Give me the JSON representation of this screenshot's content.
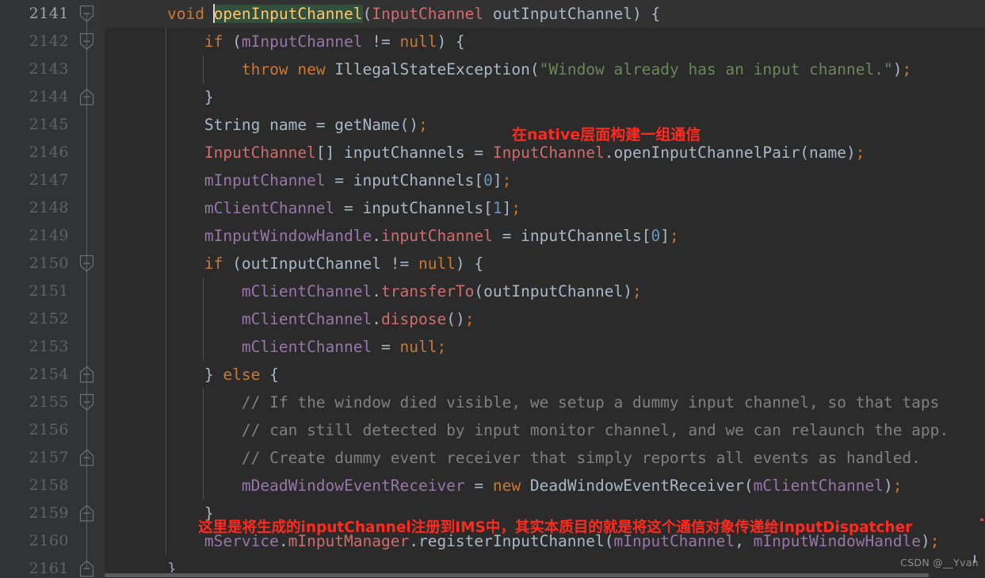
{
  "editor": {
    "first_line": 2141,
    "current_line": 2141,
    "line_numbers": [
      2141,
      2142,
      2143,
      2144,
      2145,
      2146,
      2147,
      2148,
      2149,
      2150,
      2151,
      2152,
      2153,
      2154,
      2155,
      2156,
      2157,
      2158,
      2159,
      2160,
      2161
    ],
    "colors": {
      "background": "#2b2b2b",
      "gutter_background": "#313335",
      "current_line_background": "#323232",
      "line_number": "#606366",
      "current_line_number": "#a4a3a3",
      "default_text": "#a9b7c6",
      "keyword": "#cc7832",
      "class_name": "#d06c6c",
      "field": "#9876aa",
      "string": "#6a8759",
      "number": "#6897bb",
      "comment": "#808080",
      "caret_highlight_bg": "#32503c",
      "caret_highlight_fg": "#ffc66d",
      "annotation_red": "#ff2a1e",
      "indent_guide": "#4b5059",
      "fold_marker": "#6e7072"
    },
    "lines": [
      {
        "n": 2141,
        "current": true,
        "indent": 1,
        "tokens": [
          {
            "t": "    ",
            "c": "plain"
          },
          {
            "t": "void",
            "c": "kw"
          },
          {
            "t": " ",
            "c": "plain"
          },
          {
            "t": "CARET",
            "c": "caret"
          },
          {
            "t": "openInputChannel",
            "c": "hl-ident"
          },
          {
            "t": "(",
            "c": "paren"
          },
          {
            "t": "InputChannel",
            "c": "cls"
          },
          {
            "t": " outInputChannel",
            "c": "plain"
          },
          {
            "t": ") {",
            "c": "plain"
          }
        ]
      },
      {
        "n": 2142,
        "indent": 2,
        "tokens": [
          {
            "t": "        ",
            "c": "plain"
          },
          {
            "t": "if",
            "c": "kw"
          },
          {
            "t": " (",
            "c": "plain"
          },
          {
            "t": "mInputChannel",
            "c": "field"
          },
          {
            "t": " != ",
            "c": "plain"
          },
          {
            "t": "null",
            "c": "kw"
          },
          {
            "t": ") {",
            "c": "plain"
          }
        ]
      },
      {
        "n": 2143,
        "indent": 3,
        "tokens": [
          {
            "t": "            ",
            "c": "plain"
          },
          {
            "t": "throw",
            "c": "kw"
          },
          {
            "t": " ",
            "c": "plain"
          },
          {
            "t": "new",
            "c": "kw"
          },
          {
            "t": " IllegalStateException",
            "c": "plain"
          },
          {
            "t": "(",
            "c": "paren"
          },
          {
            "t": "\"Window already has an input channel.\"",
            "c": "str"
          },
          {
            "t": ")",
            "c": "paren"
          },
          {
            "t": ";",
            "c": "semi"
          }
        ]
      },
      {
        "n": 2144,
        "indent": 2,
        "tokens": [
          {
            "t": "        }",
            "c": "plain"
          }
        ]
      },
      {
        "n": 2145,
        "indent": 2,
        "tokens": [
          {
            "t": "        String name = getName()",
            "c": "plain"
          },
          {
            "t": ";",
            "c": "semi"
          }
        ]
      },
      {
        "n": 2146,
        "indent": 2,
        "tokens": [
          {
            "t": "        ",
            "c": "plain"
          },
          {
            "t": "InputChannel",
            "c": "cls"
          },
          {
            "t": "[] inputChannels = ",
            "c": "plain"
          },
          {
            "t": "InputChannel",
            "c": "cls"
          },
          {
            "t": ".openInputChannelPair(name)",
            "c": "plain"
          },
          {
            "t": ";",
            "c": "semi"
          }
        ]
      },
      {
        "n": 2147,
        "indent": 2,
        "tokens": [
          {
            "t": "        ",
            "c": "plain"
          },
          {
            "t": "mInputChannel",
            "c": "field"
          },
          {
            "t": " = inputChannels[",
            "c": "plain"
          },
          {
            "t": "0",
            "c": "num"
          },
          {
            "t": "]",
            "c": "plain"
          },
          {
            "t": ";",
            "c": "semi"
          }
        ]
      },
      {
        "n": 2148,
        "indent": 2,
        "tokens": [
          {
            "t": "        ",
            "c": "plain"
          },
          {
            "t": "mClientChannel",
            "c": "field"
          },
          {
            "t": " = inputChannels[",
            "c": "plain"
          },
          {
            "t": "1",
            "c": "num"
          },
          {
            "t": "]",
            "c": "plain"
          },
          {
            "t": ";",
            "c": "semi"
          }
        ]
      },
      {
        "n": 2149,
        "indent": 2,
        "tokens": [
          {
            "t": "        ",
            "c": "plain"
          },
          {
            "t": "mInputWindowHandle",
            "c": "field"
          },
          {
            "t": ".",
            "c": "plain"
          },
          {
            "t": "inputChannel",
            "c": "cls"
          },
          {
            "t": " = inputChannels[",
            "c": "plain"
          },
          {
            "t": "0",
            "c": "num"
          },
          {
            "t": "]",
            "c": "plain"
          },
          {
            "t": ";",
            "c": "semi"
          }
        ]
      },
      {
        "n": 2150,
        "indent": 2,
        "tokens": [
          {
            "t": "        ",
            "c": "plain"
          },
          {
            "t": "if",
            "c": "kw"
          },
          {
            "t": " (outInputChannel != ",
            "c": "plain"
          },
          {
            "t": "null",
            "c": "kw"
          },
          {
            "t": ") {",
            "c": "plain"
          }
        ]
      },
      {
        "n": 2151,
        "indent": 3,
        "tokens": [
          {
            "t": "            ",
            "c": "plain"
          },
          {
            "t": "mClientChannel",
            "c": "field"
          },
          {
            "t": ".",
            "c": "plain"
          },
          {
            "t": "transferTo",
            "c": "mcall"
          },
          {
            "t": "(outInputChannel)",
            "c": "plain"
          },
          {
            "t": ";",
            "c": "semi"
          }
        ]
      },
      {
        "n": 2152,
        "indent": 3,
        "tokens": [
          {
            "t": "            ",
            "c": "plain"
          },
          {
            "t": "mClientChannel",
            "c": "field"
          },
          {
            "t": ".",
            "c": "plain"
          },
          {
            "t": "dispose",
            "c": "mcall"
          },
          {
            "t": "()",
            "c": "plain"
          },
          {
            "t": ";",
            "c": "semi"
          }
        ]
      },
      {
        "n": 2153,
        "indent": 3,
        "tokens": [
          {
            "t": "            ",
            "c": "plain"
          },
          {
            "t": "mClientChannel",
            "c": "field"
          },
          {
            "t": " = ",
            "c": "plain"
          },
          {
            "t": "null",
            "c": "kw"
          },
          {
            "t": ";",
            "c": "semi"
          }
        ]
      },
      {
        "n": 2154,
        "indent": 2,
        "tokens": [
          {
            "t": "        } ",
            "c": "plain"
          },
          {
            "t": "else",
            "c": "kw"
          },
          {
            "t": " {",
            "c": "plain"
          }
        ]
      },
      {
        "n": 2155,
        "indent": 3,
        "tokens": [
          {
            "t": "            ",
            "c": "plain"
          },
          {
            "t": "// If the window died visible, we setup a dummy input channel, so that taps",
            "c": "cmt"
          }
        ]
      },
      {
        "n": 2156,
        "indent": 3,
        "tokens": [
          {
            "t": "            ",
            "c": "plain"
          },
          {
            "t": "// can still detected by input monitor channel, and we can relaunch the app.",
            "c": "cmt"
          }
        ]
      },
      {
        "n": 2157,
        "indent": 3,
        "tokens": [
          {
            "t": "            ",
            "c": "plain"
          },
          {
            "t": "// Create dummy event receiver that simply reports all events as handled.",
            "c": "cmt"
          }
        ]
      },
      {
        "n": 2158,
        "indent": 3,
        "tokens": [
          {
            "t": "            ",
            "c": "plain"
          },
          {
            "t": "mDeadWindowEventReceiver",
            "c": "field"
          },
          {
            "t": " = ",
            "c": "plain"
          },
          {
            "t": "new",
            "c": "kw"
          },
          {
            "t": " DeadWindowEventReceiver(",
            "c": "plain"
          },
          {
            "t": "mClientChannel",
            "c": "field"
          },
          {
            "t": ")",
            "c": "plain"
          },
          {
            "t": ";",
            "c": "semi"
          }
        ]
      },
      {
        "n": 2159,
        "indent": 2,
        "tokens": [
          {
            "t": "        }",
            "c": "plain"
          }
        ]
      },
      {
        "n": 2160,
        "indent": 2,
        "tokens": [
          {
            "t": "        ",
            "c": "plain"
          },
          {
            "t": "mService",
            "c": "field"
          },
          {
            "t": ".",
            "c": "plain"
          },
          {
            "t": "mInputManager",
            "c": "cls"
          },
          {
            "t": ".registerInputChannel(",
            "c": "plain"
          },
          {
            "t": "mInputChannel",
            "c": "field"
          },
          {
            "t": ", ",
            "c": "plain"
          },
          {
            "t": "mInputWindowHandle",
            "c": "field"
          },
          {
            "t": ")",
            "c": "plain"
          },
          {
            "t": ";",
            "c": "semi"
          }
        ]
      },
      {
        "n": 2161,
        "indent": 1,
        "tokens": [
          {
            "t": "    }",
            "c": "brace"
          }
        ]
      }
    ],
    "fold_markers": [
      {
        "line": 2141,
        "type": "expanded-start"
      },
      {
        "line": 2142,
        "type": "expanded-start"
      },
      {
        "line": 2144,
        "type": "expanded-end"
      },
      {
        "line": 2150,
        "type": "expanded-start"
      },
      {
        "line": 2154,
        "type": "expanded-end"
      },
      {
        "line": 2155,
        "type": "expanded-start"
      },
      {
        "line": 2157,
        "type": "expanded-end"
      },
      {
        "line": 2159,
        "type": "expanded-end"
      },
      {
        "line": 2161,
        "type": "expanded-end"
      }
    ]
  },
  "annotations": [
    {
      "id": "annot-native",
      "text": "在native层面构建一组通信"
    },
    {
      "id": "annot-register",
      "text": "这里是将生成的inputChannel注册到IMS中，其实本质目的就是将这个通信对象传递给InputDispatcher"
    }
  ],
  "watermark": {
    "text": "CSDN @__Yvan"
  }
}
